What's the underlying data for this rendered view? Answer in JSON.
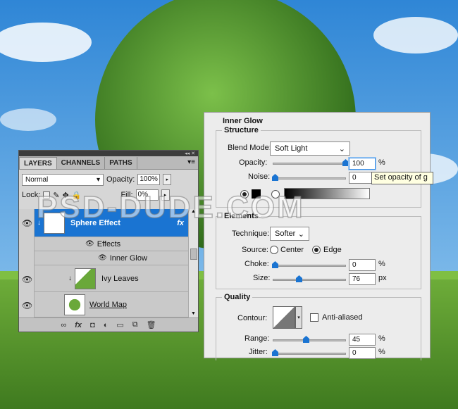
{
  "watermark": "PSD-DUDE.COM",
  "layers_panel": {
    "tabs": [
      "LAYERS",
      "CHANNELS",
      "PATHS"
    ],
    "blend_mode": "Normal",
    "opacity_label": "Opacity:",
    "opacity_value": "100%",
    "lock_label": "Lock:",
    "fill_label": "Fill:",
    "fill_value": "0%",
    "layers": [
      {
        "name": "Sphere Effect",
        "fx": "fx",
        "selected": true
      },
      {
        "name": "Effects"
      },
      {
        "name": "Inner Glow"
      },
      {
        "name": "Ivy Leaves"
      },
      {
        "name": "World Map"
      }
    ],
    "bottom_icons": [
      "link-icon",
      "fx-icon",
      "mask-icon",
      "adjustment-icon",
      "folder-icon",
      "new-layer-icon",
      "trash-icon"
    ],
    "fx_label": "fx"
  },
  "dialog": {
    "title": "Inner Glow",
    "structure": {
      "title": "Structure",
      "blend_mode_label": "Blend Mode:",
      "blend_mode_value": "Soft Light",
      "opacity_label": "Opacity:",
      "opacity_value": "100",
      "opacity_unit": "%",
      "noise_label": "Noise:",
      "noise_value": "0",
      "noise_unit": "%",
      "tooltip": "Set opacity of g"
    },
    "elements": {
      "title": "Elements",
      "technique_label": "Technique:",
      "technique_value": "Softer",
      "source_label": "Source:",
      "source_center": "Center",
      "source_edge": "Edge",
      "choke_label": "Choke:",
      "choke_value": "0",
      "choke_unit": "%",
      "size_label": "Size:",
      "size_value": "76",
      "size_unit": "px"
    },
    "quality": {
      "title": "Quality",
      "contour_label": "Contour:",
      "anti_aliased_label": "Anti-aliased",
      "range_label": "Range:",
      "range_value": "45",
      "range_unit": "%",
      "jitter_label": "Jitter:",
      "jitter_value": "0",
      "jitter_unit": "%"
    }
  },
  "colors": {
    "selection": "#1a74d2",
    "sky": "#59a6e0",
    "grass": "#4f8d2a"
  }
}
